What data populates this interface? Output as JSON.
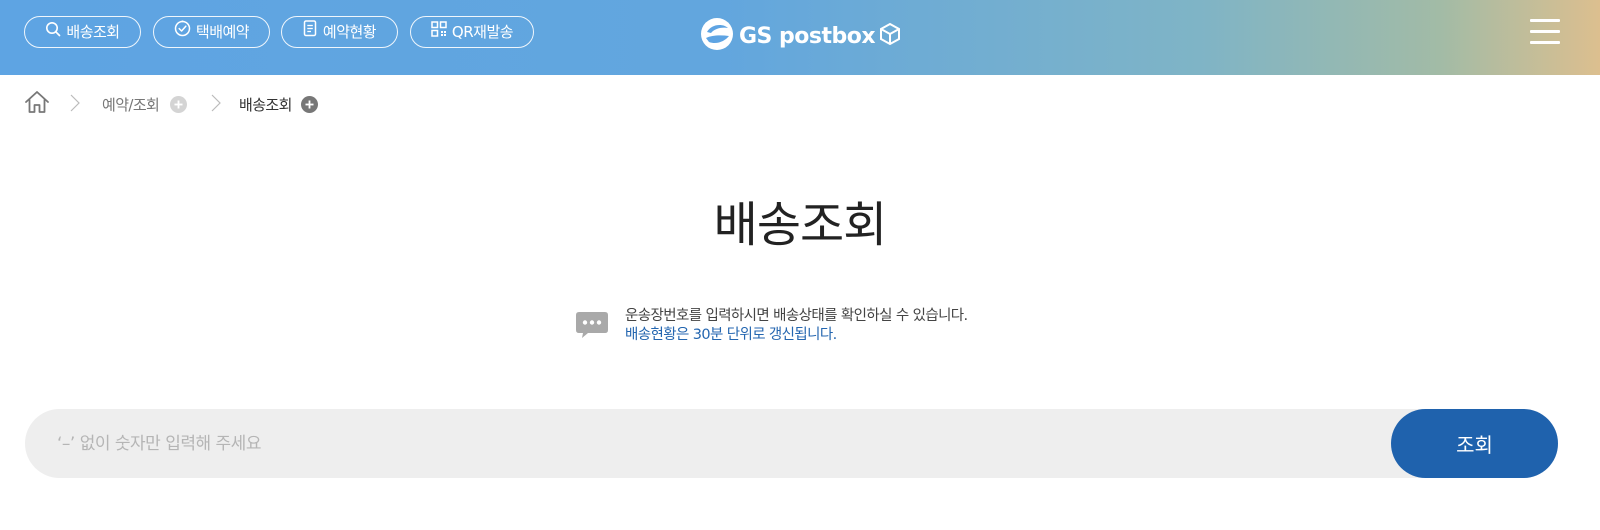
{
  "nav": {
    "items": [
      {
        "label": "배송조회",
        "icon": "search-icon"
      },
      {
        "label": "택배예약",
        "icon": "clock-check-icon"
      },
      {
        "label": "예약현황",
        "icon": "document-icon"
      },
      {
        "label": "QR재발송",
        "icon": "qr-code-icon"
      }
    ],
    "logo_text": "GS postbox",
    "menu_icon": "hamburger-menu-icon"
  },
  "breadcrumb": {
    "home_icon": "home-icon",
    "items": [
      "예약/조회",
      "배송조회"
    ]
  },
  "page": {
    "title": "배송조회",
    "info_line1": "운송장번호를 입력하시면 배송상태를 확인하실 수 있습니다.",
    "info_line2": "배송현황은 30분 단위로 갱신됩니다."
  },
  "search": {
    "placeholder": "‘–’ 없이 숫자만 입력해 주세요",
    "value": "",
    "button_label": "조회"
  },
  "colors": {
    "header_start": "#5ea4e3",
    "header_end": "#dcbf8f",
    "accent": "#1f62ad",
    "info_link": "#2466b0",
    "search_bg": "#eeeeee"
  }
}
